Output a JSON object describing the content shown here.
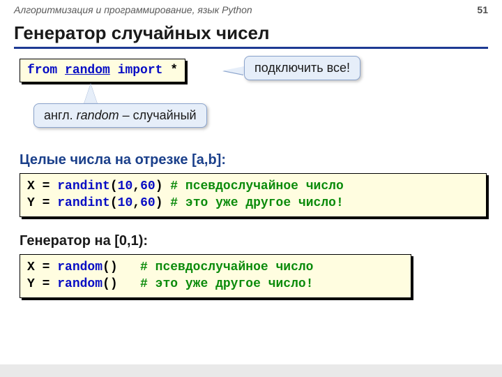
{
  "header": {
    "course": "Алгоритмизация и программирование, язык Python",
    "page": "51"
  },
  "title": "Генератор случайных чисел",
  "import_line": {
    "kw_from": "from",
    "module": "random",
    "kw_import": "import",
    "star": "*"
  },
  "callouts": {
    "connect": "подключить все!",
    "translate_pre": "англ. ",
    "translate_word": "random",
    "translate_post": " – случайный"
  },
  "section1": {
    "heading": "Целые числа на отрезке [a,b]:",
    "line1": {
      "pre": "X = ",
      "fn": "randint",
      "open": "(",
      "n1": "10",
      "sep": ",",
      "n2": "60",
      "close": ")",
      "comment": " # псевдослучайное число"
    },
    "line2": {
      "pre": "Y = ",
      "fn": "randint",
      "open": "(",
      "n1": "10",
      "sep": ",",
      "n2": "60",
      "close": ")",
      "comment": " # это уже другое число!"
    }
  },
  "section2": {
    "heading": "Генератор на [0,1):",
    "line1": {
      "pre": "X = ",
      "fn": "random",
      "parens": "()",
      "spacer": "   ",
      "comment": "# псевдослучайное число"
    },
    "line2": {
      "pre": "Y = ",
      "fn": "random",
      "parens": "()",
      "spacer": "   ",
      "comment": "# это уже другое число!"
    }
  }
}
